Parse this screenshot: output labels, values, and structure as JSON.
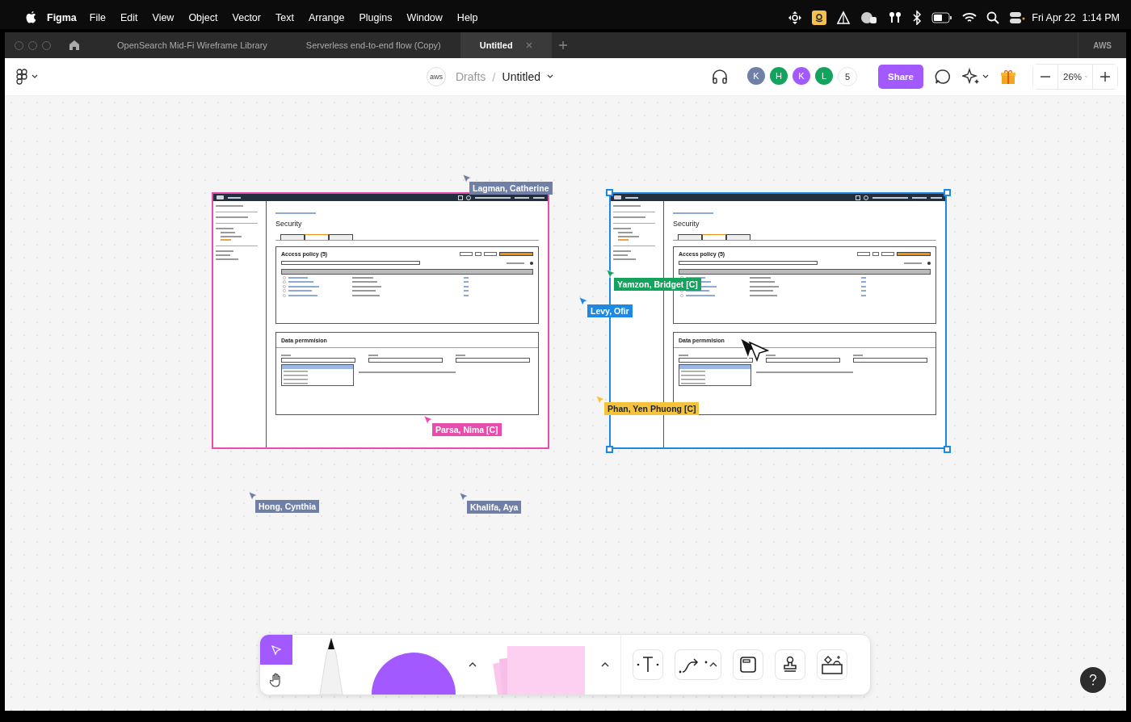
{
  "menubar": {
    "app": "Figma",
    "menus": [
      "File",
      "Edit",
      "View",
      "Object",
      "Vector",
      "Text",
      "Arrange",
      "Plugins",
      "Window",
      "Help"
    ],
    "date": "Fri Apr 22",
    "time": "1:14 PM"
  },
  "tabs": [
    {
      "label": "OpenSearch Mid-Fi Wireframe Library",
      "selected": false
    },
    {
      "label": "Serverless end-to-end flow (Copy)",
      "selected": false
    },
    {
      "label": "Untitled",
      "selected": true
    }
  ],
  "tabbar_label": "AWS",
  "toolbar": {
    "team": "aws",
    "breadcrumb_parent": "Drafts",
    "separator": "/",
    "file_name": "Untitled",
    "avatars": [
      {
        "initial": "K",
        "color": "#6f7fa6"
      },
      {
        "initial": "H",
        "color": "#14a35c"
      },
      {
        "initial": "K",
        "color": "#a259ff"
      },
      {
        "initial": "L",
        "color": "#14a35c"
      }
    ],
    "more_count": "5",
    "share": "Share",
    "zoom": "26%"
  },
  "canvas": {
    "frames": [
      {
        "color": "#e84dad",
        "selected": false,
        "wireframe": {
          "title": "Security",
          "tabs": [
            {
              "selected": false
            },
            {
              "selected": true
            },
            {
              "selected": false
            }
          ],
          "policy_title": "Access policy (5)",
          "permission_title": "Data permmision",
          "options": [
            {
              "selected": true
            },
            {
              "selected": false
            },
            {
              "selected": false
            },
            {
              "selected": false
            },
            {
              "selected": false
            }
          ]
        }
      },
      {
        "color": "#1e88e5",
        "selected": true,
        "wireframe": {
          "title": "Security",
          "tabs": [
            {
              "selected": false
            },
            {
              "selected": true
            },
            {
              "selected": false
            }
          ],
          "policy_title": "Access policy (5)",
          "permission_title": "Data permmision",
          "options": [
            {
              "selected": true
            },
            {
              "selected": false
            },
            {
              "selected": false
            },
            {
              "selected": false
            },
            {
              "selected": false
            }
          ]
        }
      }
    ],
    "cursors": [
      {
        "name": "Lagman, Catherine",
        "color": "#6f7fa6"
      },
      {
        "name": "Yamzon, Bridget [C]",
        "color": "#14a35c"
      },
      {
        "name": "Levy, Ofir",
        "color": "#1e88e5"
      },
      {
        "name": "Phan, Yen Phuong [C]",
        "color": "#f5c33b"
      },
      {
        "name": "Parsa, Nima [C]",
        "color": "#e84dad"
      },
      {
        "name": "Hong, Cynthia",
        "color": "#6f7fa6"
      },
      {
        "name": "Khalifa, Aya",
        "color": "#6f7fa6"
      }
    ]
  },
  "tools": [
    {
      "kind": "move",
      "selected": true
    },
    {
      "kind": "hand",
      "selected": false
    }
  ]
}
